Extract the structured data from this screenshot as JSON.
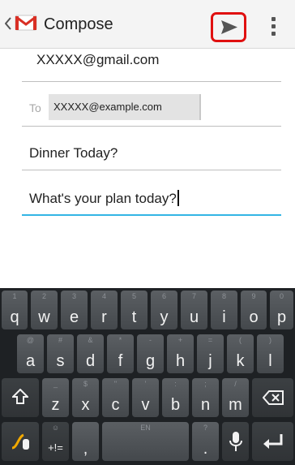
{
  "actionbar": {
    "title": "Compose",
    "icons": [
      "back-caret-icon",
      "gmail-icon",
      "send-icon",
      "overflow-menu-icon"
    ],
    "send_highlight_color": "#e01010"
  },
  "compose": {
    "from": "XXXXX@gmail.com",
    "to_label": "To",
    "to_recipient": "XXXXX@example.com",
    "subject": "Dinner Today?",
    "body": "What's your plan today?"
  },
  "keyboard": {
    "row1": [
      {
        "key": "q",
        "alt": "1"
      },
      {
        "key": "w",
        "alt": "2"
      },
      {
        "key": "e",
        "alt": "3"
      },
      {
        "key": "r",
        "alt": "4"
      },
      {
        "key": "t",
        "alt": "5"
      },
      {
        "key": "y",
        "alt": "6"
      },
      {
        "key": "u",
        "alt": "7"
      },
      {
        "key": "i",
        "alt": "8"
      },
      {
        "key": "o",
        "alt": "9"
      },
      {
        "key": "p",
        "alt": "0"
      }
    ],
    "row2": [
      {
        "key": "a",
        "alt": "@"
      },
      {
        "key": "s",
        "alt": "#"
      },
      {
        "key": "d",
        "alt": "&"
      },
      {
        "key": "f",
        "alt": "*"
      },
      {
        "key": "g",
        "alt": "-"
      },
      {
        "key": "h",
        "alt": "+"
      },
      {
        "key": "j",
        "alt": "="
      },
      {
        "key": "k",
        "alt": "("
      },
      {
        "key": "l",
        "alt": ")"
      }
    ],
    "row3": [
      {
        "key": "z",
        "alt": "_"
      },
      {
        "key": "x",
        "alt": "$"
      },
      {
        "key": "c",
        "alt": "\""
      },
      {
        "key": "v",
        "alt": "'"
      },
      {
        "key": "b",
        "alt": ":"
      },
      {
        "key": "n",
        "alt": ";"
      },
      {
        "key": "m",
        "alt": "/"
      }
    ],
    "symbols_label": "+!=",
    "symbols_alt": "☺",
    "comma": ",",
    "period": ".",
    "period_alt": "?",
    "space_alt": "EN",
    "accent_color": "#f2a900"
  }
}
